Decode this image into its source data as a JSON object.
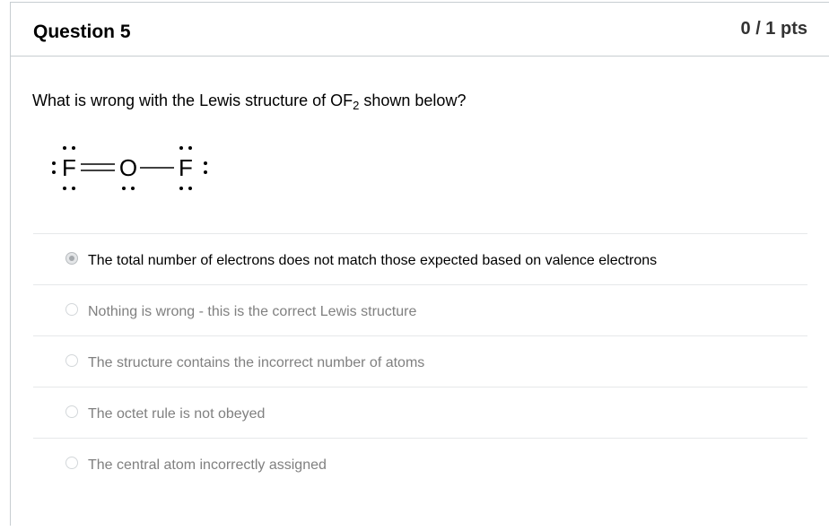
{
  "question": {
    "title": "Question 5",
    "points": "0 / 1 pts",
    "text_before": "What is wrong with the Lewis structure of OF",
    "text_sub": "2",
    "text_after": " shown below?"
  },
  "lewis_structure": {
    "atom_left": "F",
    "atom_center": "O",
    "atom_right": "F",
    "bond_left": "double",
    "bond_right": "single"
  },
  "answers": [
    {
      "label": "The total number of electrons does not match those expected based on valence electrons",
      "selected": true
    },
    {
      "label": "Nothing is wrong - this is the correct Lewis structure",
      "selected": false
    },
    {
      "label": "The structure contains the incorrect number of atoms",
      "selected": false
    },
    {
      "label": "The octet rule is not obeyed",
      "selected": false
    },
    {
      "label": "The central atom incorrectly assigned",
      "selected": false
    }
  ]
}
